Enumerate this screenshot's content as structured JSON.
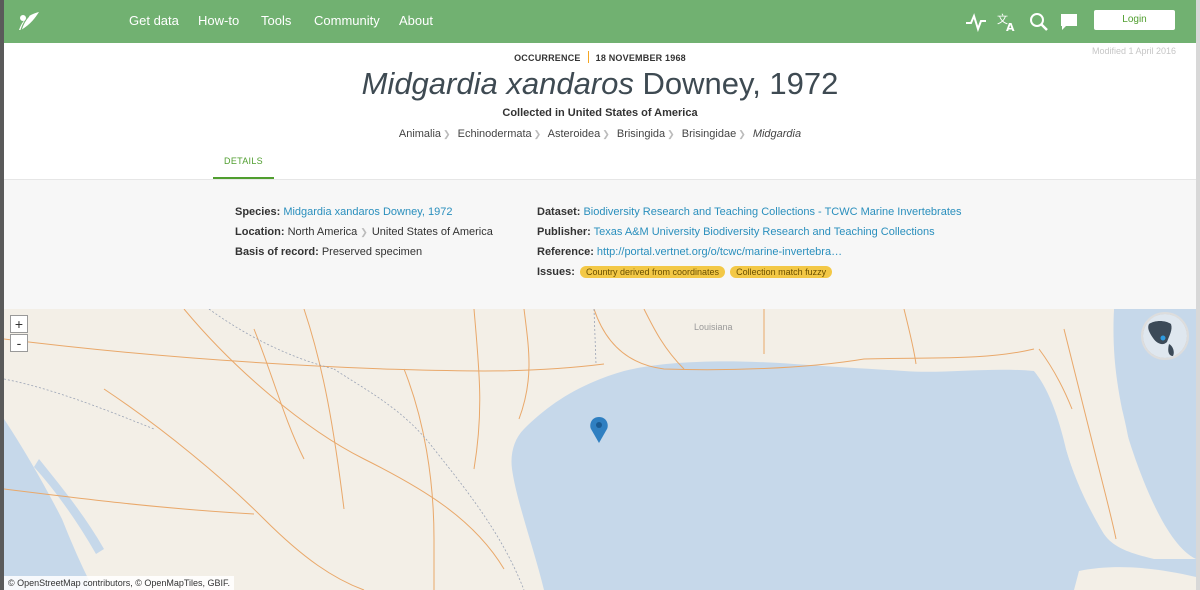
{
  "header": {
    "nav": [
      "Get data",
      "How-to",
      "Tools",
      "Community",
      "About"
    ],
    "login_label": "Login",
    "icons": [
      "activity-icon",
      "translate-icon",
      "search-icon",
      "chat-icon"
    ]
  },
  "record": {
    "type_label": "OCCURRENCE",
    "event_date": "18 NOVEMBER 1968",
    "modified": "Modified 1 April 2016",
    "title_italic": "Midgardia xandaros",
    "title_author": "Downey, 1972",
    "collected": "Collected in United States of America",
    "taxonomy": [
      "Animalia",
      "Echinodermata",
      "Asteroidea",
      "Brisingida",
      "Brisingidae",
      "Midgardia"
    ]
  },
  "tabs": {
    "details": "DETAILS"
  },
  "details": {
    "species_label": "Species:",
    "species_value": "Midgardia xandaros Downey, 1972",
    "location_label": "Location:",
    "location_continent": "North America",
    "location_country": "United States of America",
    "basis_label": "Basis of record:",
    "basis_value": "Preserved specimen",
    "dataset_label": "Dataset:",
    "dataset_value": "Biodiversity Research and Teaching Collections - TCWC Marine Invertebrates",
    "publisher_label": "Publisher:",
    "publisher_value": "Texas A&M University Biodiversity Research and Teaching Collections",
    "reference_label": "Reference:",
    "reference_value": "http://portal.vertnet.org/o/tcwc/marine-invertebra…",
    "issues_label": "Issues:",
    "issues": [
      "Country derived from coordinates",
      "Collection match fuzzy"
    ]
  },
  "map": {
    "zoom_in": "+",
    "zoom_out": "-",
    "place_label": "Louisiana",
    "attribution": "© OpenStreetMap contributors, © OpenMapTiles, GBIF.",
    "water_color": "#c6d8ea",
    "land_color": "#f3efe7",
    "road_color": "#e9a86a",
    "marker_color": "#2f7fc1"
  },
  "colors": {
    "brand_green": "#71b171",
    "link_blue": "#2a8fbd",
    "badge_yellow": "#f3c846"
  }
}
